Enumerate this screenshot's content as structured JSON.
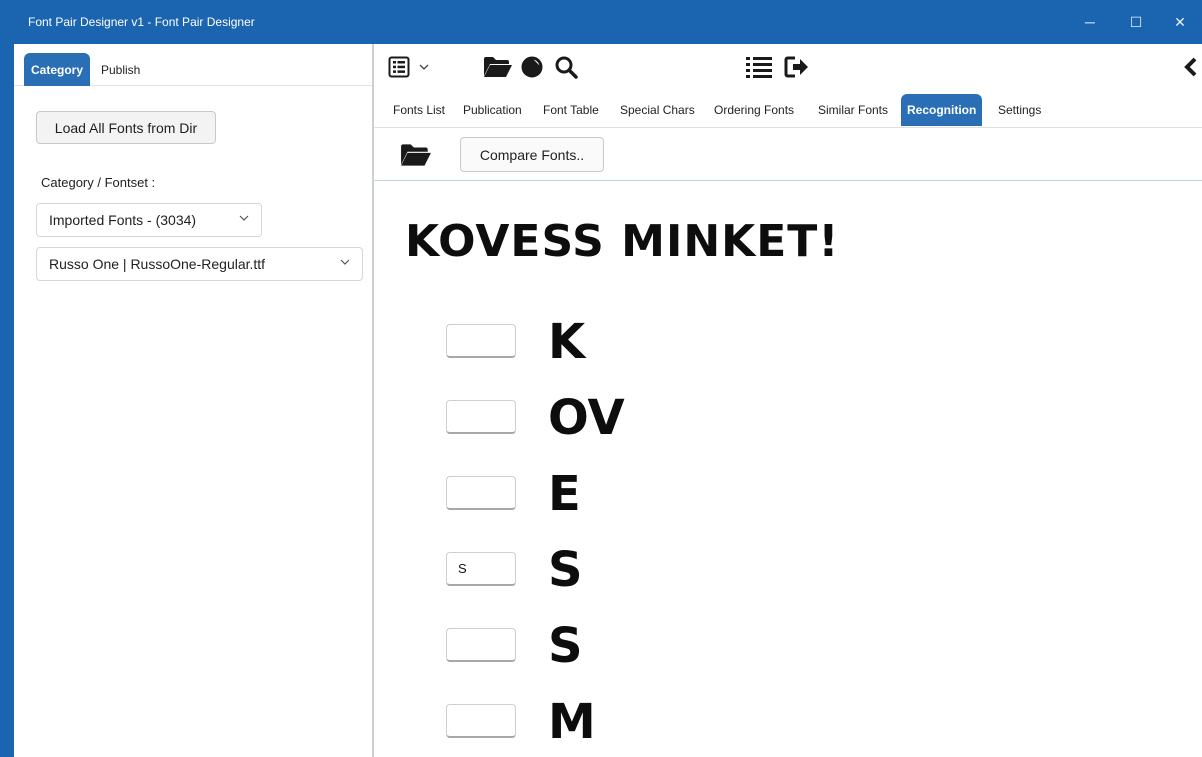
{
  "window": {
    "title": "Font Pair Designer v1 - Font Pair Designer",
    "minimize_glyph": "─",
    "maximize_glyph": "☐",
    "close_glyph": "✕"
  },
  "left": {
    "tabs": [
      {
        "label": "Category",
        "active": true
      },
      {
        "label": "Publish",
        "active": false
      }
    ],
    "load_button": "Load All Fonts from Dir",
    "category_label": "Category / Fontset :",
    "fontset_select": "Imported Fonts - (3034)",
    "font_select": "Russo One | RussoOne-Regular.ttf"
  },
  "toolbar": {
    "icons": [
      "menu-icon",
      "chevron-down-icon",
      "folder-open-icon",
      "contrast-icon",
      "search-icon",
      "list-icon",
      "exit-icon",
      "back-chevron-icon"
    ]
  },
  "tabs": [
    {
      "label": "Fonts List",
      "active": false
    },
    {
      "label": "Publication",
      "active": false
    },
    {
      "label": "Font Table",
      "active": false
    },
    {
      "label": "Special Chars",
      "active": false
    },
    {
      "label": "Ordering Fonts",
      "active": false
    },
    {
      "label": "Similar Fonts",
      "active": false
    },
    {
      "label": "Recognition",
      "active": true
    },
    {
      "label": "Settings",
      "active": false
    }
  ],
  "subtoolbar": {
    "compare_button": "Compare Fonts.."
  },
  "recognition": {
    "headline": "KOVESS MINKET!",
    "rows": [
      {
        "input": "",
        "glyph": "K"
      },
      {
        "input": "",
        "glyph": "OV"
      },
      {
        "input": "",
        "glyph": "E"
      },
      {
        "input": "S",
        "glyph": "S"
      },
      {
        "input": "",
        "glyph": "S"
      },
      {
        "input": "",
        "glyph": "M"
      }
    ]
  },
  "colors": {
    "titlebar": "#1b64b0",
    "active_tab": "#2a6fb5"
  }
}
